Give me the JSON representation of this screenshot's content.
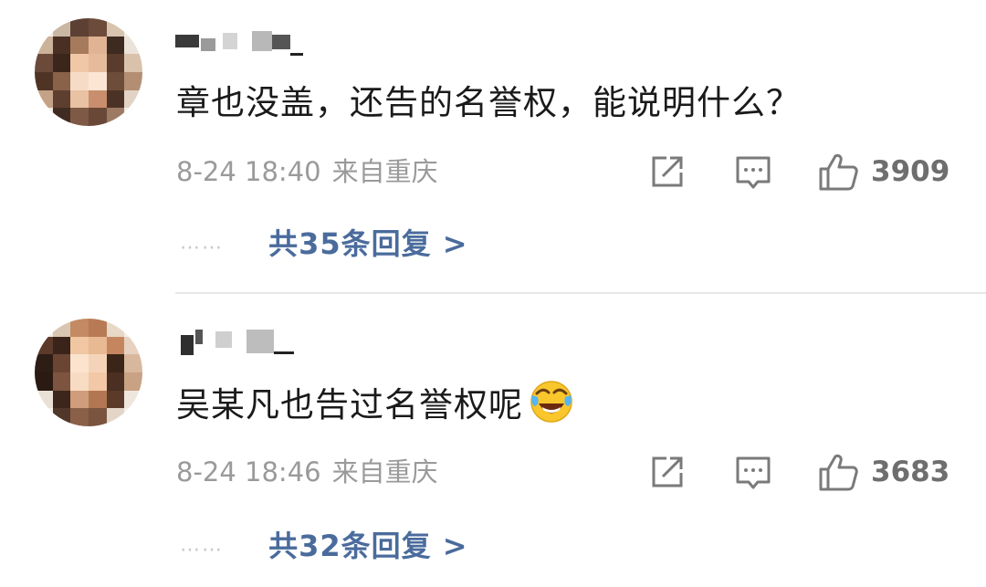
{
  "comments": [
    {
      "text": "章也没盖，还告的名誉权，能说明什么？",
      "date": "8-24 18:40",
      "location": "来自重庆",
      "likes": "3909",
      "replies": "共35条回复 >"
    },
    {
      "text": "吴某凡也告过名誉权呢",
      "emoji": "crying-laughing-emoji",
      "date": "8-24 18:46",
      "location": "来自重庆",
      "likes": "3683",
      "replies": "共32条回复 >"
    }
  ],
  "icons": {
    "share": "share-icon",
    "comment": "comment-icon",
    "like": "thumbs-up-icon"
  },
  "colors": {
    "text": "#1a1a1a",
    "meta": "#9a9a9a",
    "link": "#4a6b9c",
    "icon": "#7a7a7a"
  }
}
